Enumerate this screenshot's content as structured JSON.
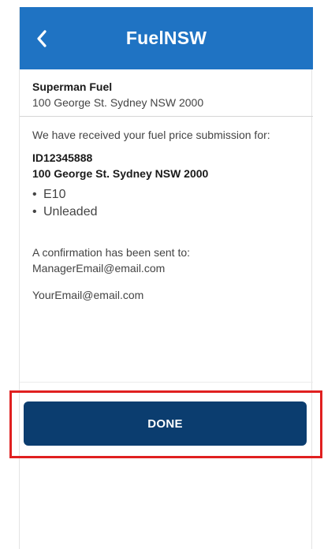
{
  "header": {
    "title": "FuelNSW",
    "back_icon": "chevron-left-icon",
    "color": "#1f73c3"
  },
  "station": {
    "name": "Superman Fuel",
    "address": "100 George St. Sydney NSW 2000"
  },
  "submission": {
    "message": "We have received your fuel price submission for:",
    "id": "ID12345888",
    "address": "100 George St. Sydney NSW 2000",
    "fuels": [
      "E10",
      "Unleaded"
    ]
  },
  "confirmation": {
    "message": "A confirmation has been sent to:",
    "manager_email": "ManagerEmail@email.com",
    "your_email": "YourEmail@email.com"
  },
  "done_button": {
    "label": "DONE",
    "color": "#0b3d6f",
    "highlight_color": "#e02020"
  }
}
